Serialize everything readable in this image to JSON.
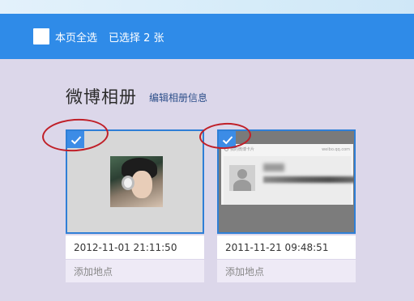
{
  "toolbar": {
    "select_all_label": "本页全选",
    "selected_count_label": "已选择 2 张"
  },
  "album": {
    "title": "微博相册",
    "edit_link": "编辑相册信息"
  },
  "photos": [
    {
      "selected": true,
      "timestamp": "2012-11-01 21:11:50",
      "location_label": "添加地点"
    },
    {
      "selected": true,
      "timestamp": "2011-11-21 09:48:51",
      "location_label": "添加地点",
      "thumb_header_left": "我的微博卡片",
      "thumb_header_right": "weibo.qq.com"
    }
  ],
  "colors": {
    "toolbar_bg": "#2f8be8",
    "content_bg": "#dcd7ea",
    "selection_border": "#2f7fd6",
    "annotation_circle": "#c01f28"
  },
  "icons": [
    "checkbox-unchecked-icon",
    "checkmark-icon",
    "default-avatar-icon"
  ]
}
